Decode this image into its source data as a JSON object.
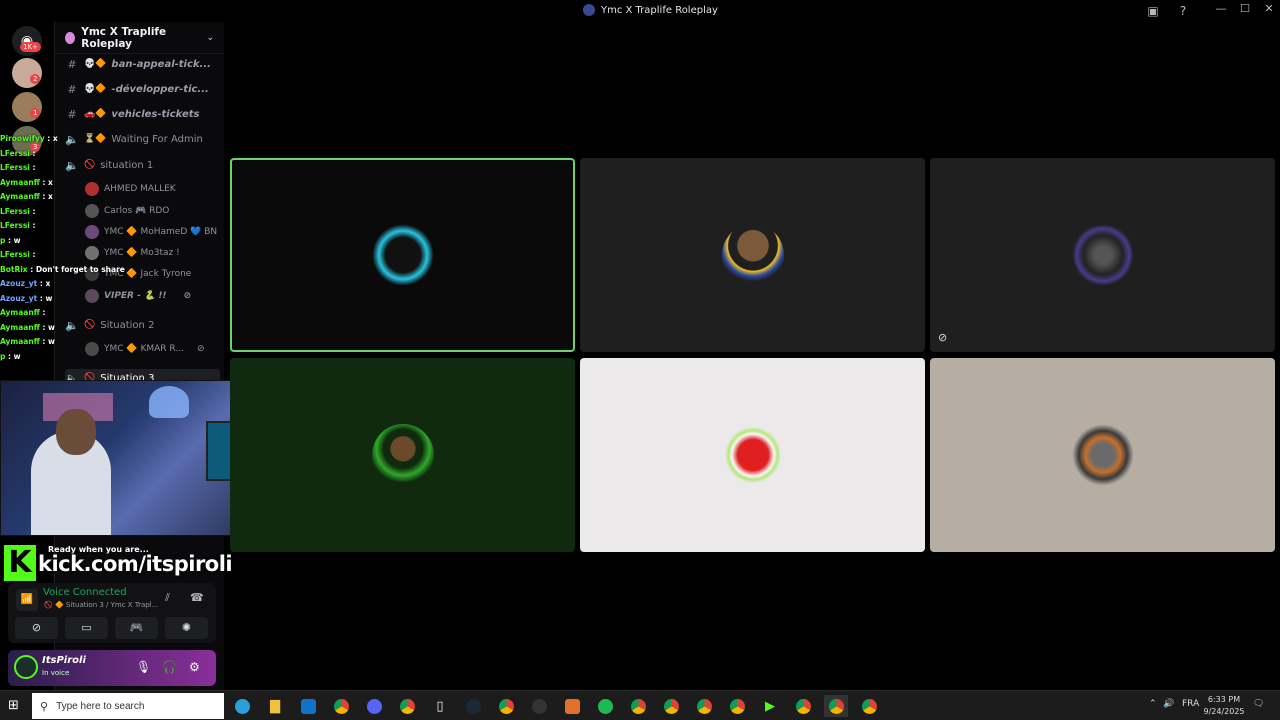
{
  "window": {
    "title": "Ymc X Traplife Roleplay"
  },
  "server": {
    "name": "Ymc X Traplife Roleplay",
    "badges": [
      "1K+",
      "2",
      "1",
      "3"
    ]
  },
  "channels": [
    {
      "prefix": "💀🔶",
      "label": "ban-appeal-tick..."
    },
    {
      "prefix": "💀🔶",
      "label": "-développer-tic..."
    },
    {
      "prefix": "🚗🔶",
      "label": "vehicles-tickets"
    },
    {
      "prefix": "⏳🔶",
      "label": "Waiting For Admin"
    },
    {
      "prefix": "🚫",
      "label": "situation 1"
    },
    {
      "prefix": "🚫",
      "label": "Situation 2"
    },
    {
      "prefix": "🚫",
      "label": "Situation 3"
    }
  ],
  "voice_users": [
    {
      "name": "AHMED MALLEK"
    },
    {
      "name": "Carlos 🎮 RDO"
    },
    {
      "name": "YMC 🔶 MoHameD 💙 BN"
    },
    {
      "name": "YMC 🔶 Mo3taz !"
    },
    {
      "name": "YMC 🔶 Jack Tyrone"
    },
    {
      "name": "VIPER - 🐍 !!"
    },
    {
      "name": "YMC 🔶 KMAR R..."
    }
  ],
  "chat_overlay": [
    {
      "user": "Piroowifyy",
      "msg": ": x"
    },
    {
      "user": "LFerssi",
      "msg": ":"
    },
    {
      "user": "LFerssi",
      "msg": ":"
    },
    {
      "user": "Aymaanff",
      "msg": ": x"
    },
    {
      "user": "Aymaanff",
      "msg": ": x"
    },
    {
      "user": "LFerssi",
      "msg": ":"
    },
    {
      "user": "LFerssi",
      "msg": ":"
    },
    {
      "user": "p",
      "msg": ": w"
    },
    {
      "user": "LFerssi",
      "msg": ":"
    },
    {
      "user": "BotRix",
      "msg": ": Don't forget to share"
    },
    {
      "user": "Azouz_yt",
      "msg": ": x"
    },
    {
      "user": "Azouz_yt",
      "msg": ": w"
    },
    {
      "user": "Aymaanff",
      "msg": ":"
    },
    {
      "user": "Aymaanff",
      "msg": ": w"
    },
    {
      "user": "Aymaanff",
      "msg": ": w"
    },
    {
      "user": "p",
      "msg": ": w"
    }
  ],
  "stream": {
    "ready": "Ready when you are...",
    "kick_url": "kick.com/itspiroli",
    "kick_letter": "K"
  },
  "voice_panel": {
    "status": "Voice Connected",
    "channel": "🚫 🔶 Situation 3 / Ymc X Trapl..."
  },
  "user": {
    "name": "ItsPiroli",
    "status": "In voice"
  },
  "taskbar": {
    "search_placeholder": "Type here to search",
    "lang": "FRA",
    "time": "6:33 PM",
    "date": "9/24/2025"
  },
  "colors": {
    "kick_green": "#53fc18",
    "discord_green": "#23a55a",
    "speaking_border": "#6ad46a"
  }
}
